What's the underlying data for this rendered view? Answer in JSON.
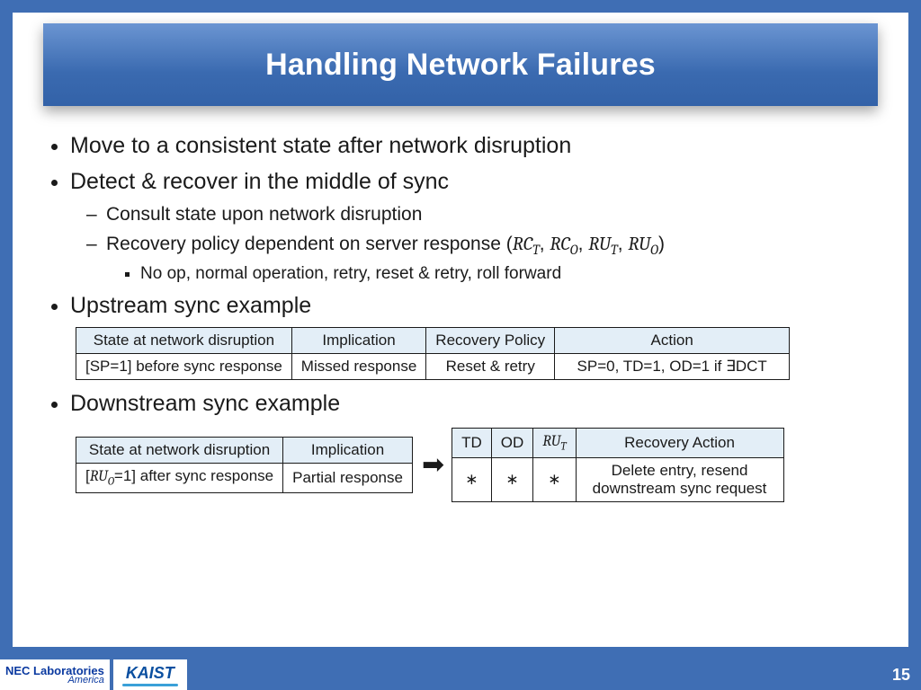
{
  "title": "Handling Network Failures",
  "bullets": {
    "b1": "Move to a consistent state after network disruption",
    "b2": "Detect & recover in the middle of sync",
    "b2a": "Consult state upon network disruption",
    "b2b_pre": "Recovery policy dependent on server response (",
    "b2b_rc_t": "RC",
    "b2b_rc_t_sub": "T",
    "b2b_rc_o": "RC",
    "b2b_rc_o_sub": "O",
    "b2b_ru_t": "RU",
    "b2b_ru_t_sub": "T",
    "b2b_ru_o": "RU",
    "b2b_ru_o_sub": "O",
    "b2b_post": ")",
    "b2b1": "No op, normal operation, retry, reset & retry, roll forward",
    "b3": "Upstream sync example",
    "b4": "Downstream sync example"
  },
  "table1": {
    "h1": "State at network disruption",
    "h2": "Implication",
    "h3": "Recovery Policy",
    "h4": "Action",
    "r1c1": "[SP=1] before sync response",
    "r1c2": "Missed response",
    "r1c3": "Reset & retry",
    "r1c4_pre": "SP=0, TD=1, OD=1 if ",
    "r1c4_exists": "∃",
    "r1c4_post": "DCT"
  },
  "table2a": {
    "h1": "State at network disruption",
    "h2": "Implication",
    "r1c1_pre": "[",
    "r1c1_ru": "RU",
    "r1c1_sub": "O",
    "r1c1_post": "=1] after sync response",
    "r1c2": "Partial response"
  },
  "table2b": {
    "h1": "TD",
    "h2": "OD",
    "h3_ru": "RU",
    "h3_sub": "T",
    "h4": "Recovery Action",
    "r1c1": "∗",
    "r1c2": "∗",
    "r1c3": "∗",
    "r1c4": "Delete entry, resend downstream sync request"
  },
  "page_number": "15",
  "logos": {
    "nec_line1": "NEC Laboratories",
    "nec_line2": "America",
    "kaist": "KAIST"
  },
  "sep": ", "
}
